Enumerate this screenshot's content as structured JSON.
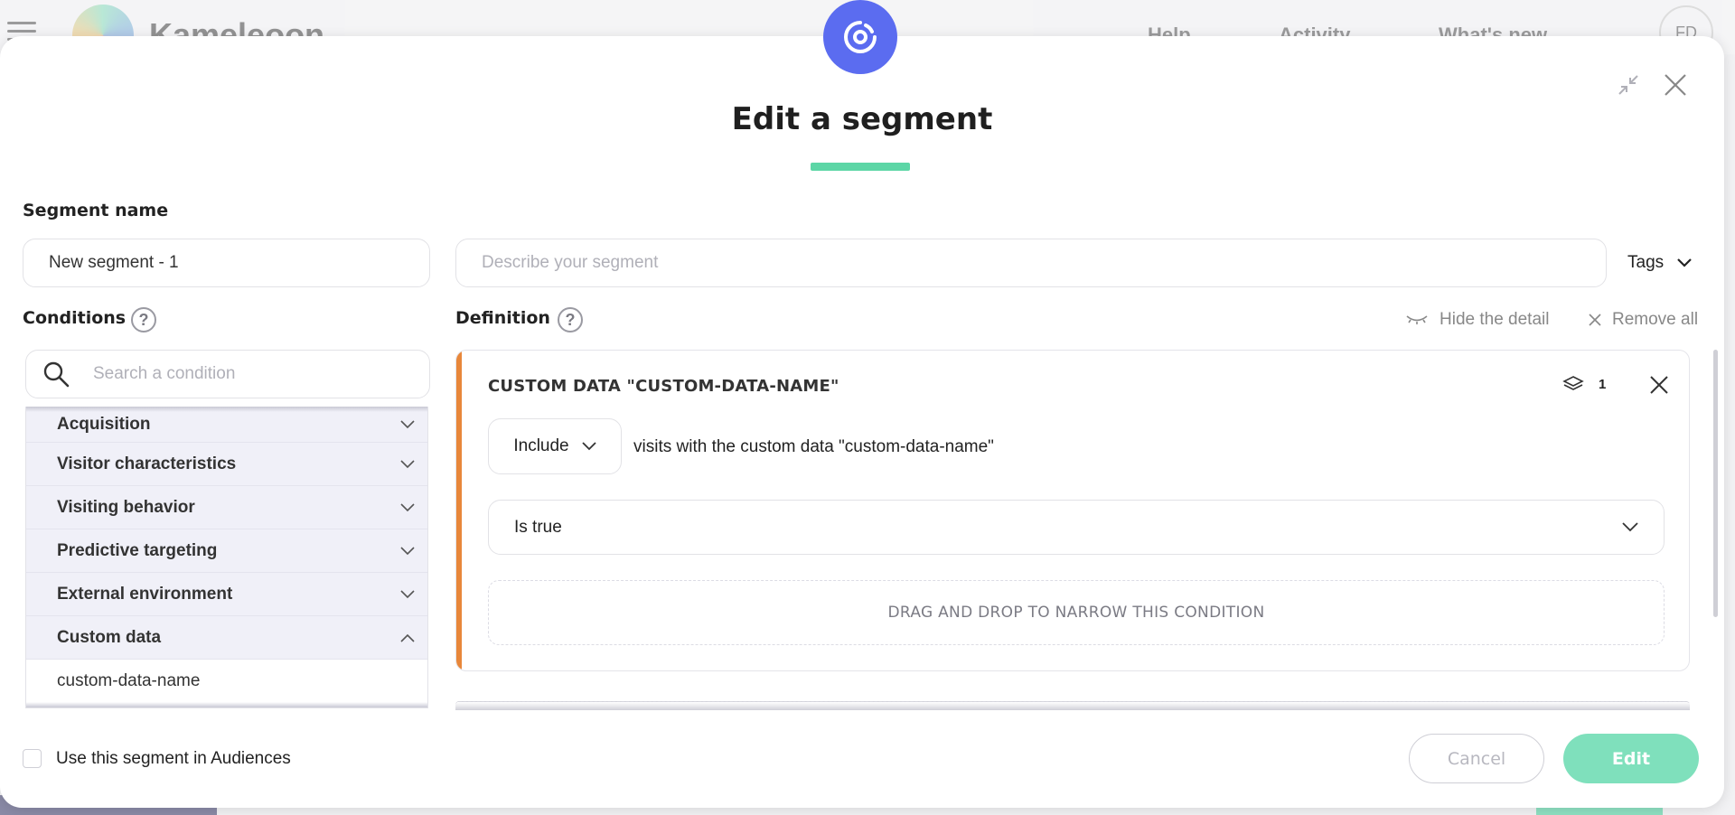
{
  "background_app": {
    "brand": "Kameleoon",
    "nav": [
      "Help",
      "Activity",
      "What's new"
    ],
    "avatar_initials": "FD"
  },
  "modal": {
    "title": "Edit a segment",
    "accent_color": "#5cd6a6",
    "badge_color": "#5b6cf0"
  },
  "segment": {
    "name_label": "Segment name",
    "name_value": "New segment - 1",
    "description_placeholder": "Describe your segment",
    "tags_label": "Tags"
  },
  "conditions": {
    "label": "Conditions",
    "help": "?",
    "search_placeholder": "Search a condition",
    "categories": [
      {
        "label": "Acquisition",
        "expanded": false
      },
      {
        "label": "Visitor characteristics",
        "expanded": false
      },
      {
        "label": "Visiting behavior",
        "expanded": false
      },
      {
        "label": "Predictive targeting",
        "expanded": false
      },
      {
        "label": "External environment",
        "expanded": false
      },
      {
        "label": "Custom data",
        "expanded": true
      }
    ],
    "custom_data_items": [
      "custom-data-name"
    ]
  },
  "definition": {
    "label": "Definition",
    "help": "?",
    "hide_detail": "Hide the detail",
    "remove_all": "Remove all",
    "card": {
      "title": "CUSTOM DATA \"CUSTOM-DATA-NAME\"",
      "layer_count": "1",
      "include_value": "Include",
      "include_text": "visits with the custom data \"custom-data-name\"",
      "condition_value": "Is true",
      "dropzone_text": "DRAG AND DROP TO NARROW THIS CONDITION",
      "accent_color": "#e8873a"
    }
  },
  "footer": {
    "audience_checkbox_label": "Use this segment in Audiences",
    "audience_checked": false,
    "cancel_label": "Cancel",
    "edit_label": "Edit"
  }
}
